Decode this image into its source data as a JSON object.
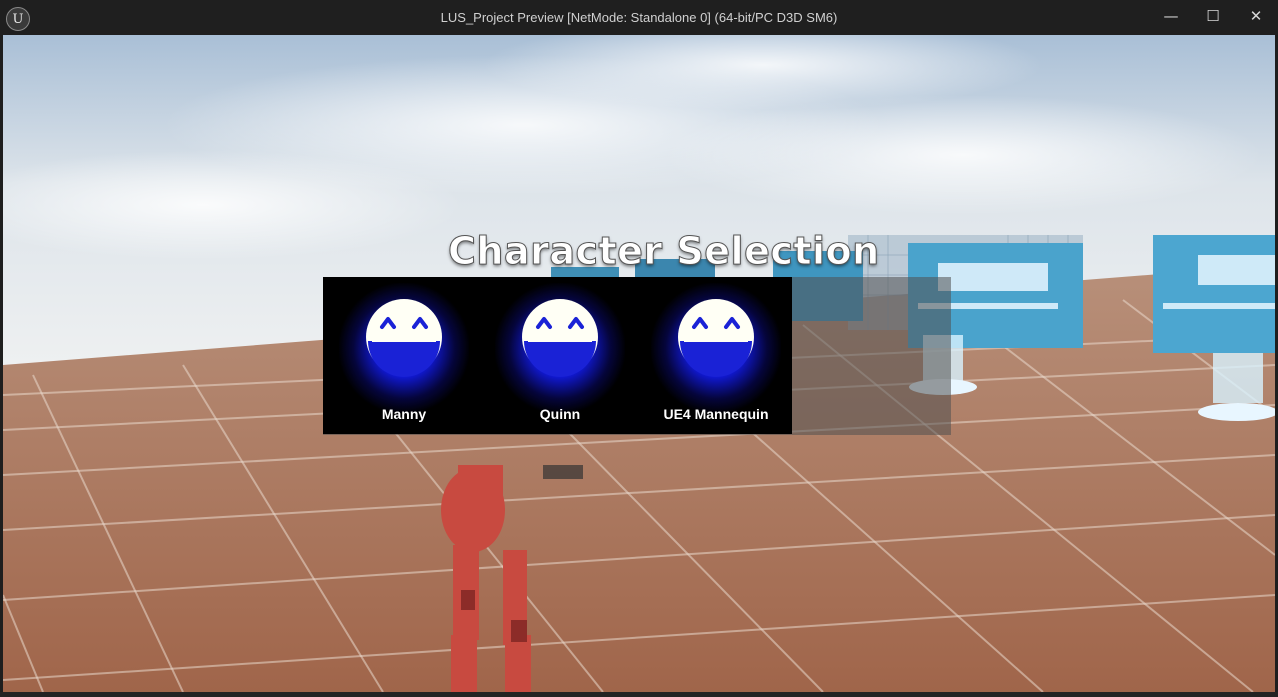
{
  "window": {
    "title": "LUS_Project Preview [NetMode: Standalone 0]  (64-bit/PC D3D SM6)",
    "logo_glyph": "U",
    "minimize_glyph": "—",
    "maximize_glyph": "☐",
    "close_glyph": "✕"
  },
  "heading": "Character Selection",
  "characters": [
    {
      "name": "Manny",
      "icon": "laughing-face-icon"
    },
    {
      "name": "Quinn",
      "icon": "laughing-face-icon"
    },
    {
      "name": "UE4 Mannequin",
      "icon": "laughing-face-icon"
    }
  ],
  "colors": {
    "icon_face": "#fffff5",
    "icon_mouth": "#1a22d6",
    "icon_glow": "#1420ff"
  }
}
